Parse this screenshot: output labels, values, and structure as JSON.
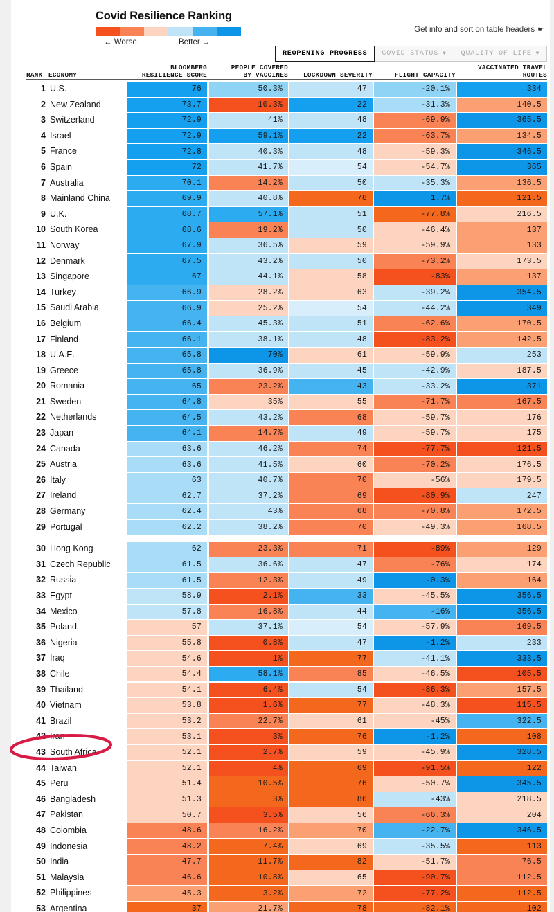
{
  "header": {
    "title": "Covid Resilience Ranking",
    "legend": {
      "worse_label": "← Worse",
      "better_label": "Better →",
      "colors": [
        "#f4511e",
        "#f98355",
        "#fcd4bf",
        "#bfe3f7",
        "#45b3ef",
        "#0d96e8"
      ]
    },
    "get_info_text": "Get info and sort on table headers",
    "get_info_icon": "cursor-pointer-icon",
    "tabs": [
      {
        "label": "REOPENING PROGRESS",
        "active": true,
        "caret": ""
      },
      {
        "label": "COVID STATUS",
        "active": false,
        "caret": "▼"
      },
      {
        "label": "QUALITY OF LIFE",
        "active": false,
        "caret": "▼"
      }
    ]
  },
  "columns": {
    "rank": "RANK",
    "economy": "ECONOMY",
    "score": "BLOOMBERG\nRESILIENCE SCORE",
    "vaccines": "PEOPLE COVERED\nBY VACCINES",
    "lockdown": "LOCKDOWN SEVERITY",
    "flight": "FLIGHT CAPACITY",
    "travel": "VACCINATED TRAVEL\nROUTES"
  },
  "annotation": {
    "type": "red-ellipse",
    "target_row": 44,
    "color": "#d81b45"
  },
  "chart_data": {
    "type": "table",
    "title": "Covid Resilience Ranking",
    "legend_scale": [
      "Worse",
      "Better"
    ],
    "columns": [
      "RANK",
      "ECONOMY",
      "BLOOMBERG RESILIENCE SCORE",
      "PEOPLE COVERED BY VACCINES",
      "LOCKDOWN SEVERITY",
      "FLIGHT CAPACITY",
      "VACCINATED TRAVEL ROUTES"
    ],
    "rows": [
      {
        "rank": "1",
        "economy": "U.S.",
        "score": "76",
        "sc": "#14a0ef",
        "vax": "50.3%",
        "vc": "#8fd3f5",
        "lock": "47",
        "lc": "#bfe3f7",
        "flight": "-20.1%",
        "fc": "#8fd3f5",
        "travel": "334",
        "tc": "#14a0ef"
      },
      {
        "rank": "2",
        "economy": "New Zealand",
        "score": "73.7",
        "sc": "#14a0ef",
        "vax": "10.3%",
        "vc": "#f4511e",
        "lock": "22",
        "lc": "#14a0ef",
        "flight": "-31.3%",
        "fc": "#a8dcf7",
        "travel": "140.5",
        "tc": "#fba073"
      },
      {
        "rank": "3",
        "economy": "Switzerland",
        "score": "72.9",
        "sc": "#14a0ef",
        "vax": "41%",
        "vc": "#bfe3f7",
        "lock": "48",
        "lc": "#bfe3f7",
        "flight": "-69.9%",
        "fc": "#f98355",
        "travel": "365.5",
        "tc": "#0d96e8"
      },
      {
        "rank": "4",
        "economy": "Israel",
        "score": "72.9",
        "sc": "#14a0ef",
        "vax": "59.1%",
        "vc": "#14a0ef",
        "lock": "22",
        "lc": "#14a0ef",
        "flight": "-63.7%",
        "fc": "#f98355",
        "travel": "134.5",
        "tc": "#fba073"
      },
      {
        "rank": "5",
        "economy": "France",
        "score": "72.8",
        "sc": "#14a0ef",
        "vax": "40.3%",
        "vc": "#bfe3f7",
        "lock": "48",
        "lc": "#bfe3f7",
        "flight": "-59.3%",
        "fc": "#fcd4bf",
        "travel": "346.5",
        "tc": "#0d96e8"
      },
      {
        "rank": "6",
        "economy": "Spain",
        "score": "72",
        "sc": "#14a0ef",
        "vax": "41.7%",
        "vc": "#bfe3f7",
        "lock": "54",
        "lc": "#d8eefb",
        "flight": "-54.7%",
        "fc": "#fcd4bf",
        "travel": "365",
        "tc": "#0d96e8"
      },
      {
        "rank": "7",
        "economy": "Australia",
        "score": "70.1",
        "sc": "#2cabf0",
        "vax": "14.2%",
        "vc": "#f98355",
        "lock": "50",
        "lc": "#bfe3f7",
        "flight": "-35.3%",
        "fc": "#bfe3f7",
        "travel": "136.5",
        "tc": "#fba073"
      },
      {
        "rank": "8",
        "economy": "Mainland China",
        "score": "69.9",
        "sc": "#2cabf0",
        "vax": "40.8%",
        "vc": "#bfe3f7",
        "lock": "78",
        "lc": "#f4681e",
        "flight": "1.7%",
        "fc": "#0d96e8",
        "travel": "121.5",
        "tc": "#f4681e"
      },
      {
        "rank": "9",
        "economy": "U.K.",
        "score": "68.7",
        "sc": "#2cabf0",
        "vax": "57.1%",
        "vc": "#2cabf0",
        "lock": "51",
        "lc": "#bfe3f7",
        "flight": "-77.8%",
        "fc": "#f4681e",
        "travel": "216.5",
        "tc": "#fcd4bf"
      },
      {
        "rank": "10",
        "economy": "South Korea",
        "score": "68.6",
        "sc": "#2cabf0",
        "vax": "19.2%",
        "vc": "#f98355",
        "lock": "50",
        "lc": "#bfe3f7",
        "flight": "-46.4%",
        "fc": "#fcd4bf",
        "travel": "137",
        "tc": "#fba073"
      },
      {
        "rank": "11",
        "economy": "Norway",
        "score": "67.9",
        "sc": "#2cabf0",
        "vax": "36.5%",
        "vc": "#bfe3f7",
        "lock": "59",
        "lc": "#fcd4bf",
        "flight": "-59.9%",
        "fc": "#fcd4bf",
        "travel": "133",
        "tc": "#fba073"
      },
      {
        "rank": "12",
        "economy": "Denmark",
        "score": "67.5",
        "sc": "#2cabf0",
        "vax": "43.2%",
        "vc": "#bfe3f7",
        "lock": "50",
        "lc": "#bfe3f7",
        "flight": "-73.2%",
        "fc": "#f98355",
        "travel": "173.5",
        "tc": "#fcd4bf"
      },
      {
        "rank": "13",
        "economy": "Singapore",
        "score": "67",
        "sc": "#2cabf0",
        "vax": "44.1%",
        "vc": "#bfe3f7",
        "lock": "58",
        "lc": "#fcd4bf",
        "flight": "-83%",
        "fc": "#f4511e",
        "travel": "137",
        "tc": "#fba073"
      },
      {
        "rank": "14",
        "economy": "Turkey",
        "score": "66.9",
        "sc": "#45b3ef",
        "vax": "28.2%",
        "vc": "#fcd4bf",
        "lock": "63",
        "lc": "#fcd4bf",
        "flight": "-39.2%",
        "fc": "#bfe3f7",
        "travel": "354.5",
        "tc": "#0d96e8"
      },
      {
        "rank": "15",
        "economy": "Saudi Arabia",
        "score": "66.9",
        "sc": "#45b3ef",
        "vax": "25.2%",
        "vc": "#fcd4bf",
        "lock": "54",
        "lc": "#d8eefb",
        "flight": "-44.2%",
        "fc": "#bfe3f7",
        "travel": "349",
        "tc": "#0d96e8"
      },
      {
        "rank": "16",
        "economy": "Belgium",
        "score": "66.4",
        "sc": "#45b3ef",
        "vax": "45.3%",
        "vc": "#bfe3f7",
        "lock": "51",
        "lc": "#bfe3f7",
        "flight": "-62.6%",
        "fc": "#f98355",
        "travel": "170.5",
        "tc": "#fba073"
      },
      {
        "rank": "17",
        "economy": "Finland",
        "score": "66.1",
        "sc": "#45b3ef",
        "vax": "38.1%",
        "vc": "#bfe3f7",
        "lock": "48",
        "lc": "#bfe3f7",
        "flight": "-83.2%",
        "fc": "#f4511e",
        "travel": "142.5",
        "tc": "#fba073"
      },
      {
        "rank": "18",
        "economy": "U.A.E.",
        "score": "65.8",
        "sc": "#45b3ef",
        "vax": "70%",
        "vc": "#0d96e8",
        "lock": "61",
        "lc": "#fcd4bf",
        "flight": "-59.9%",
        "fc": "#fcd4bf",
        "travel": "253",
        "tc": "#bfe3f7"
      },
      {
        "rank": "19",
        "economy": "Greece",
        "score": "65.8",
        "sc": "#45b3ef",
        "vax": "36.9%",
        "vc": "#bfe3f7",
        "lock": "45",
        "lc": "#bfe3f7",
        "flight": "-42.9%",
        "fc": "#bfe3f7",
        "travel": "187.5",
        "tc": "#fcd4bf"
      },
      {
        "rank": "20",
        "economy": "Romania",
        "score": "65",
        "sc": "#45b3ef",
        "vax": "23.2%",
        "vc": "#f98355",
        "lock": "43",
        "lc": "#45b3ef",
        "flight": "-33.2%",
        "fc": "#bfe3f7",
        "travel": "371",
        "tc": "#0d96e8"
      },
      {
        "rank": "21",
        "economy": "Sweden",
        "score": "64.8",
        "sc": "#45b3ef",
        "vax": "35%",
        "vc": "#fcd4bf",
        "lock": "55",
        "lc": "#fcd4bf",
        "flight": "-71.7%",
        "fc": "#f98355",
        "travel": "167.5",
        "tc": "#f98355"
      },
      {
        "rank": "22",
        "economy": "Netherlands",
        "score": "64.5",
        "sc": "#45b3ef",
        "vax": "43.2%",
        "vc": "#bfe3f7",
        "lock": "68",
        "lc": "#f98355",
        "flight": "-59.7%",
        "fc": "#fcd4bf",
        "travel": "176",
        "tc": "#fcd4bf"
      },
      {
        "rank": "23",
        "economy": "Japan",
        "score": "64.1",
        "sc": "#45b3ef",
        "vax": "14.7%",
        "vc": "#f98355",
        "lock": "49",
        "lc": "#bfe3f7",
        "flight": "-59.7%",
        "fc": "#fcd4bf",
        "travel": "175",
        "tc": "#fcd4bf"
      },
      {
        "rank": "24",
        "economy": "Canada",
        "score": "63.6",
        "sc": "#a8dcf7",
        "vax": "46.2%",
        "vc": "#bfe3f7",
        "lock": "74",
        "lc": "#f98355",
        "flight": "-77.7%",
        "fc": "#f4511e",
        "travel": "121.5",
        "tc": "#f4511e"
      },
      {
        "rank": "25",
        "economy": "Austria",
        "score": "63.6",
        "sc": "#a8dcf7",
        "vax": "41.5%",
        "vc": "#bfe3f7",
        "lock": "60",
        "lc": "#fcd4bf",
        "flight": "-70.2%",
        "fc": "#f98355",
        "travel": "176.5",
        "tc": "#fcd4bf"
      },
      {
        "rank": "26",
        "economy": "Italy",
        "score": "63",
        "sc": "#a8dcf7",
        "vax": "40.7%",
        "vc": "#bfe3f7",
        "lock": "70",
        "lc": "#f98355",
        "flight": "-56%",
        "fc": "#fcd4bf",
        "travel": "179.5",
        "tc": "#fcd4bf"
      },
      {
        "rank": "27",
        "economy": "Ireland",
        "score": "62.7",
        "sc": "#a8dcf7",
        "vax": "37.2%",
        "vc": "#bfe3f7",
        "lock": "69",
        "lc": "#f98355",
        "flight": "-80.9%",
        "fc": "#f4511e",
        "travel": "247",
        "tc": "#bfe3f7"
      },
      {
        "rank": "28",
        "economy": "Germany",
        "score": "62.4",
        "sc": "#a8dcf7",
        "vax": "43%",
        "vc": "#bfe3f7",
        "lock": "68",
        "lc": "#f98355",
        "flight": "-70.8%",
        "fc": "#f98355",
        "travel": "172.5",
        "tc": "#fba073"
      },
      {
        "rank": "29",
        "economy": "Portugal",
        "score": "62.2",
        "sc": "#a8dcf7",
        "vax": "38.2%",
        "vc": "#bfe3f7",
        "lock": "70",
        "lc": "#f98355",
        "flight": "-49.3%",
        "fc": "#fcd4bf",
        "travel": "168.5",
        "tc": "#fba073"
      },
      {
        "rank": "30",
        "economy": "Hong Kong",
        "score": "62",
        "sc": "#a8dcf7",
        "vax": "23.3%",
        "vc": "#f98355",
        "lock": "71",
        "lc": "#f98355",
        "flight": "-89%",
        "fc": "#f4511e",
        "travel": "129",
        "tc": "#fba073"
      },
      {
        "rank": "31",
        "economy": "Czech Republic",
        "score": "61.5",
        "sc": "#a8dcf7",
        "vax": "36.6%",
        "vc": "#bfe3f7",
        "lock": "47",
        "lc": "#bfe3f7",
        "flight": "-76%",
        "fc": "#f98355",
        "travel": "174",
        "tc": "#fcd4bf"
      },
      {
        "rank": "32",
        "economy": "Russia",
        "score": "61.5",
        "sc": "#a8dcf7",
        "vax": "12.3%",
        "vc": "#f98355",
        "lock": "49",
        "lc": "#bfe3f7",
        "flight": "-0.3%",
        "fc": "#0d96e8",
        "travel": "164",
        "tc": "#fba073"
      },
      {
        "rank": "33",
        "economy": "Egypt",
        "score": "58.9",
        "sc": "#bfe3f7",
        "vax": "2.1%",
        "vc": "#f4511e",
        "lock": "33",
        "lc": "#45b3ef",
        "flight": "-45.5%",
        "fc": "#fcd4bf",
        "travel": "356.5",
        "tc": "#0d96e8"
      },
      {
        "rank": "34",
        "economy": "Mexico",
        "score": "57.8",
        "sc": "#bfe3f7",
        "vax": "16.8%",
        "vc": "#f98355",
        "lock": "44",
        "lc": "#bfe3f7",
        "flight": "-16%",
        "fc": "#45b3ef",
        "travel": "356.5",
        "tc": "#0d96e8"
      },
      {
        "rank": "35",
        "economy": "Poland",
        "score": "57",
        "sc": "#fcd4bf",
        "vax": "37.1%",
        "vc": "#bfe3f7",
        "lock": "54",
        "lc": "#d8eefb",
        "flight": "-57.9%",
        "fc": "#fcd4bf",
        "travel": "169.5",
        "tc": "#f98355"
      },
      {
        "rank": "36",
        "economy": "Nigeria",
        "score": "55.8",
        "sc": "#fcd4bf",
        "vax": "0.8%",
        "vc": "#f4511e",
        "lock": "47",
        "lc": "#bfe3f7",
        "flight": "-1.2%",
        "fc": "#0d96e8",
        "travel": "233",
        "tc": "#bfe3f7"
      },
      {
        "rank": "37",
        "economy": "Iraq",
        "score": "54.6",
        "sc": "#fcd4bf",
        "vax": "1%",
        "vc": "#f4511e",
        "lock": "77",
        "lc": "#f4681e",
        "flight": "-41.1%",
        "fc": "#bfe3f7",
        "travel": "333.5",
        "tc": "#0d96e8"
      },
      {
        "rank": "38",
        "economy": "Chile",
        "score": "54.4",
        "sc": "#fcd4bf",
        "vax": "58.1%",
        "vc": "#2cabf0",
        "lock": "85",
        "lc": "#f98355",
        "flight": "-46.5%",
        "fc": "#fcd4bf",
        "travel": "105.5",
        "tc": "#f4511e"
      },
      {
        "rank": "39",
        "economy": "Thailand",
        "score": "54.1",
        "sc": "#fcd4bf",
        "vax": "6.4%",
        "vc": "#f4511e",
        "lock": "54",
        "lc": "#bfe3f7",
        "flight": "-86.3%",
        "fc": "#f4511e",
        "travel": "157.5",
        "tc": "#fba073"
      },
      {
        "rank": "40",
        "economy": "Vietnam",
        "score": "53.8",
        "sc": "#fcd4bf",
        "vax": "1.6%",
        "vc": "#f4511e",
        "lock": "77",
        "lc": "#f4681e",
        "flight": "-48.3%",
        "fc": "#fcd4bf",
        "travel": "115.5",
        "tc": "#f4511e"
      },
      {
        "rank": "41",
        "economy": "Brazil",
        "score": "53.2",
        "sc": "#fcd4bf",
        "vax": "22.7%",
        "vc": "#f98355",
        "lock": "61",
        "lc": "#fcd4bf",
        "flight": "-45%",
        "fc": "#fcd4bf",
        "travel": "322.5",
        "tc": "#45b3ef"
      },
      {
        "rank": "42",
        "economy": "Iran",
        "score": "53.1",
        "sc": "#fcd4bf",
        "vax": "3%",
        "vc": "#f4511e",
        "lock": "76",
        "lc": "#f4681e",
        "flight": "-1.2%",
        "fc": "#0d96e8",
        "travel": "108",
        "tc": "#f4681e"
      },
      {
        "rank": "43",
        "economy": "South Africa",
        "score": "52.1",
        "sc": "#fcd4bf",
        "vax": "2.7%",
        "vc": "#f4511e",
        "lock": "59",
        "lc": "#fcd4bf",
        "flight": "-45.9%",
        "fc": "#fcd4bf",
        "travel": "328.5",
        "tc": "#0d96e8"
      },
      {
        "rank": "44",
        "economy": "Taiwan",
        "score": "52.1",
        "sc": "#fcd4bf",
        "vax": "4%",
        "vc": "#f4511e",
        "lock": "69",
        "lc": "#f4681e",
        "flight": "-91.5%",
        "fc": "#f4511e",
        "travel": "122",
        "tc": "#f4681e"
      },
      {
        "rank": "45",
        "economy": "Peru",
        "score": "51.4",
        "sc": "#fcd4bf",
        "vax": "10.5%",
        "vc": "#f4681e",
        "lock": "76",
        "lc": "#f4681e",
        "flight": "-50.7%",
        "fc": "#fcd4bf",
        "travel": "345.5",
        "tc": "#0d96e8"
      },
      {
        "rank": "46",
        "economy": "Bangladesh",
        "score": "51.3",
        "sc": "#fcd4bf",
        "vax": "3%",
        "vc": "#f4681e",
        "lock": "86",
        "lc": "#f4681e",
        "flight": "-43%",
        "fc": "#bfe3f7",
        "travel": "218.5",
        "tc": "#fcd4bf"
      },
      {
        "rank": "47",
        "economy": "Pakistan",
        "score": "50.7",
        "sc": "#fcd4bf",
        "vax": "3.5%",
        "vc": "#f4511e",
        "lock": "56",
        "lc": "#fcd4bf",
        "flight": "-66.3%",
        "fc": "#f98355",
        "travel": "204",
        "tc": "#fcd4bf"
      },
      {
        "rank": "48",
        "economy": "Colombia",
        "score": "48.6",
        "sc": "#f98355",
        "vax": "16.2%",
        "vc": "#f98355",
        "lock": "70",
        "lc": "#fba073",
        "flight": "-22.7%",
        "fc": "#45b3ef",
        "travel": "346.5",
        "tc": "#0d96e8"
      },
      {
        "rank": "49",
        "economy": "Indonesia",
        "score": "48.2",
        "sc": "#f98355",
        "vax": "7.4%",
        "vc": "#f4681e",
        "lock": "69",
        "lc": "#fcd4bf",
        "flight": "-35.5%",
        "fc": "#bfe3f7",
        "travel": "113",
        "tc": "#f4681e"
      },
      {
        "rank": "50",
        "economy": "India",
        "score": "47.7",
        "sc": "#f98355",
        "vax": "11.7%",
        "vc": "#f4681e",
        "lock": "82",
        "lc": "#f4681e",
        "flight": "-51.7%",
        "fc": "#fcd4bf",
        "travel": "76.5",
        "tc": "#f98355"
      },
      {
        "rank": "51",
        "economy": "Malaysia",
        "score": "46.6",
        "sc": "#f98355",
        "vax": "10.8%",
        "vc": "#f4681e",
        "lock": "65",
        "lc": "#fcd4bf",
        "flight": "-90.7%",
        "fc": "#f4511e",
        "travel": "112.5",
        "tc": "#f98355"
      },
      {
        "rank": "52",
        "economy": "Philippines",
        "score": "45.3",
        "sc": "#fba073",
        "vax": "3.2%",
        "vc": "#f4681e",
        "lock": "72",
        "lc": "#fba073",
        "flight": "-77.2%",
        "fc": "#f4511e",
        "travel": "112.5",
        "tc": "#f4681e"
      },
      {
        "rank": "53",
        "economy": "Argentina",
        "score": "37",
        "sc": "#f4681e",
        "vax": "21.7%",
        "vc": "#fba073",
        "lock": "78",
        "lc": "#f4681e",
        "flight": "-82.1%",
        "fc": "#f4681e",
        "travel": "102",
        "tc": "#f4681e"
      }
    ]
  }
}
